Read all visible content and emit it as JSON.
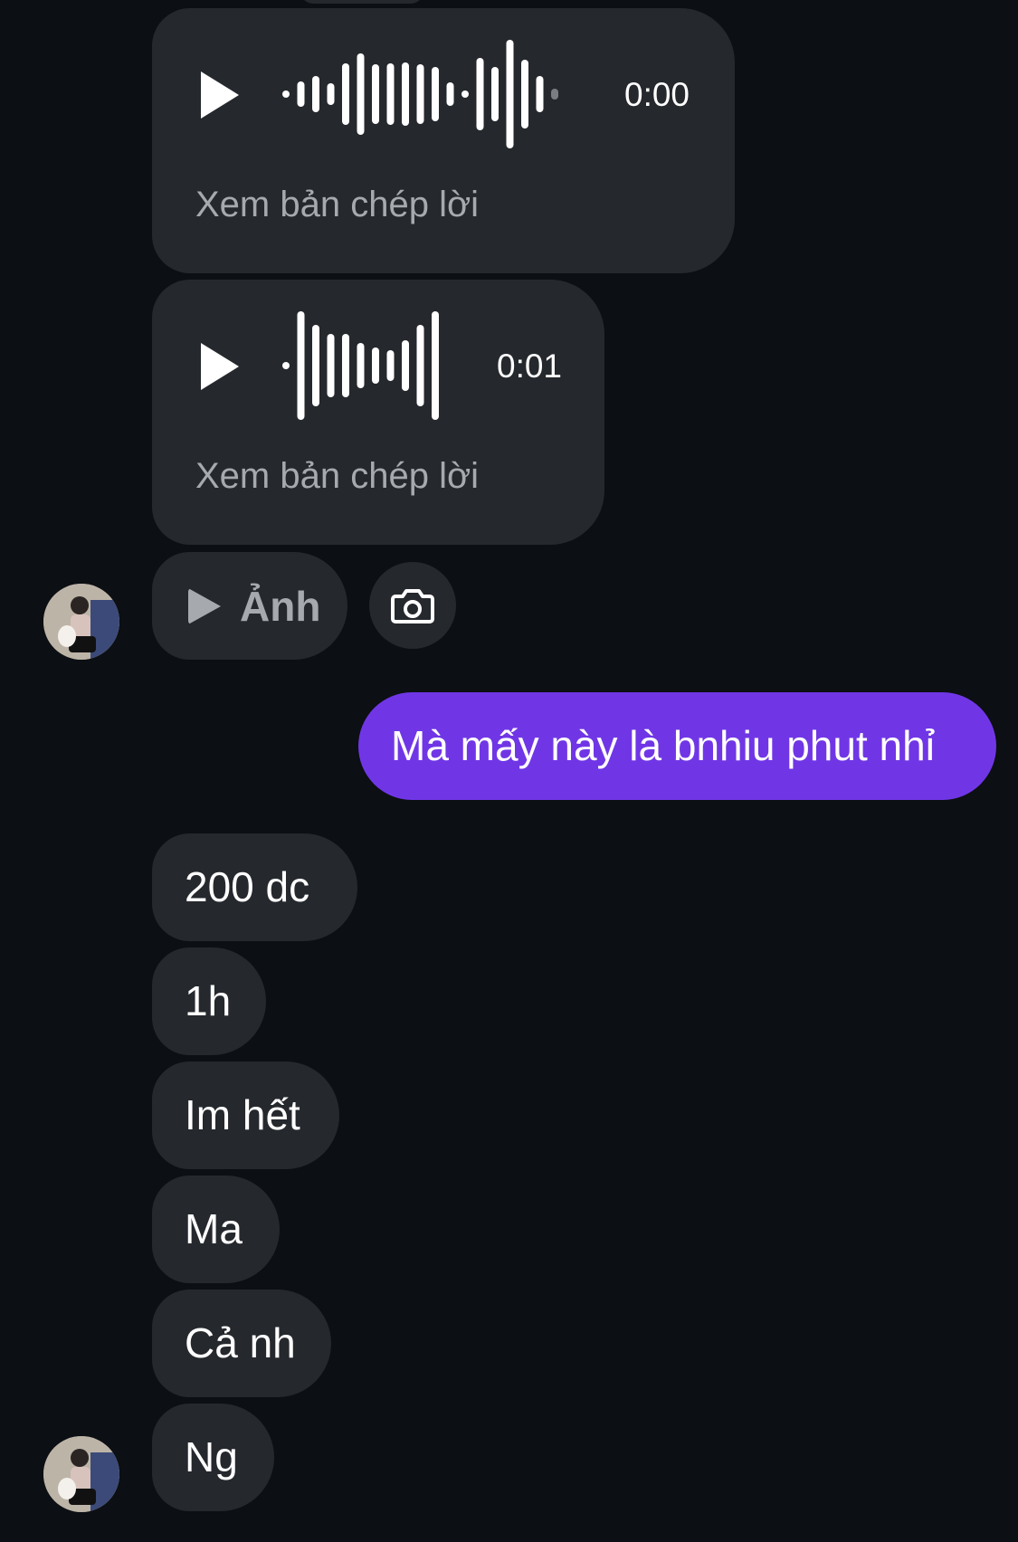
{
  "colors": {
    "background": "#0c0f13",
    "received_bubble": "#25282d",
    "sent_bubble": "#7036e6",
    "muted_text": "#a6a9ae"
  },
  "voice_messages": [
    {
      "duration": "0:00",
      "transcript_link": "Xem bản chép lời",
      "play_icon": "play-icon"
    },
    {
      "duration": "0:01",
      "transcript_link": "Xem bản chép lời",
      "play_icon": "play-icon"
    }
  ],
  "photo_message": {
    "label": "Ảnh",
    "icon": "play-icon",
    "camera_icon": "camera-icon"
  },
  "sent_messages": [
    {
      "text": "Mà mấy này là bnhiu phut nhỉ"
    }
  ],
  "received_messages": [
    {
      "text": "200 dc"
    },
    {
      "text": "1h"
    },
    {
      "text": "Im hết"
    },
    {
      "text": "Ma"
    },
    {
      "text": "Cả nh"
    },
    {
      "text": "Ng"
    }
  ]
}
